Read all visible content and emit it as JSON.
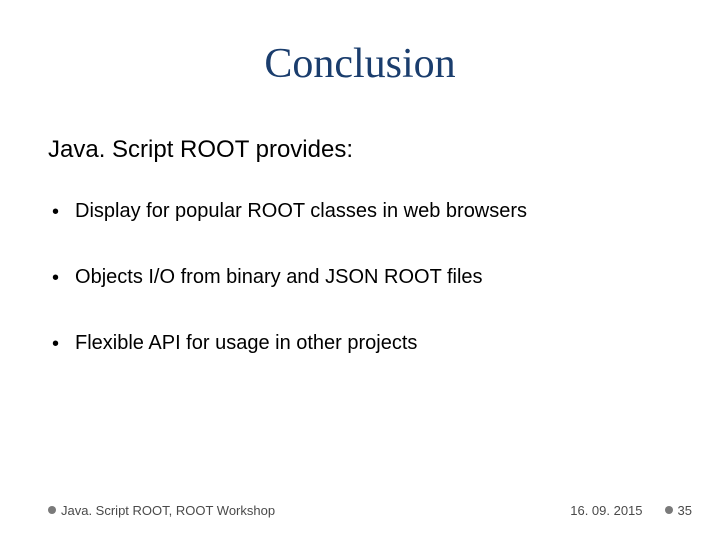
{
  "title": "Conclusion",
  "subtitle": "Java. Script ROOT provides:",
  "bullets": [
    "Display for popular ROOT classes in web browsers",
    "Objects I/O from binary and JSON ROOT files",
    "Flexible API for usage in other projects"
  ],
  "footer": {
    "left": "Java. Script ROOT, ROOT Workshop",
    "date": "16. 09. 2015",
    "page": "35"
  }
}
